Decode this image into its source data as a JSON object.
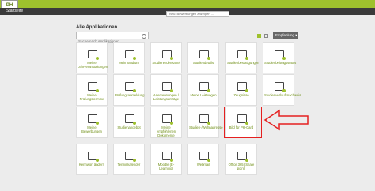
{
  "header": {
    "logo_text": "PH",
    "breadcrumb": "Startseite",
    "tooltip": "Neu: Bewerbungen anzeigen ..."
  },
  "main": {
    "title": "Alle Applikationen",
    "search_placeholder": "Suche nach Applikationen...",
    "sort_label": "Empfehlung ▾"
  },
  "tiles": [
    {
      "label": "Meine Lehrveranstaltungen",
      "icon": "easel-icon"
    },
    {
      "label": "Mein Studium",
      "icon": "desk-icon"
    },
    {
      "label": "Studierendenkartei",
      "icon": "id-card-icon"
    },
    {
      "label": "Studiendetails",
      "icon": "calendar-icon"
    },
    {
      "label": "Studienbestätigungen",
      "icon": "certificate-icon"
    },
    {
      "label": "Studienbeitragsstatus",
      "icon": "payment-icon"
    },
    {
      "label": "Meine Prüfungstermine",
      "icon": "exam-calendar-icon"
    },
    {
      "label": "Prüfungsanmeldung",
      "icon": "document-plus-icon"
    },
    {
      "label": "Anerkennungen / Leistungsanträge",
      "icon": "swap-icon"
    },
    {
      "label": "Meine Leistungen",
      "icon": "grades-icon"
    },
    {
      "label": "Zeugnisse",
      "icon": "report-icon"
    },
    {
      "label": "Studienverlaufsnachweis",
      "icon": "transcript-icon"
    },
    {
      "label": "Meine Bewerbungen",
      "icon": "application-icon"
    },
    {
      "label": "Studienangebot",
      "icon": "catalog-icon"
    },
    {
      "label": "Meine empfohlenen Dokumente",
      "icon": "documents-icon"
    },
    {
      "label": "Studien-/Wohnadresse",
      "icon": "home-icon"
    },
    {
      "label": "Bild für PH-Card",
      "icon": "photo-card-icon"
    },
    {
      "label": "Kennwort ändern",
      "icon": "lock-icon"
    },
    {
      "label": "Terminkalender",
      "icon": "calendar-17-icon"
    },
    {
      "label": "Moodle (E-Learning)",
      "icon": "moodle-icon"
    },
    {
      "label": "Webmail",
      "icon": "mail-icon"
    },
    {
      "label": "Office 365 (Share point)",
      "icon": "office-icon"
    }
  ],
  "colors": {
    "accent": "#9ec12d",
    "header_dark": "#3a3a3a",
    "highlight": "#e52020"
  }
}
